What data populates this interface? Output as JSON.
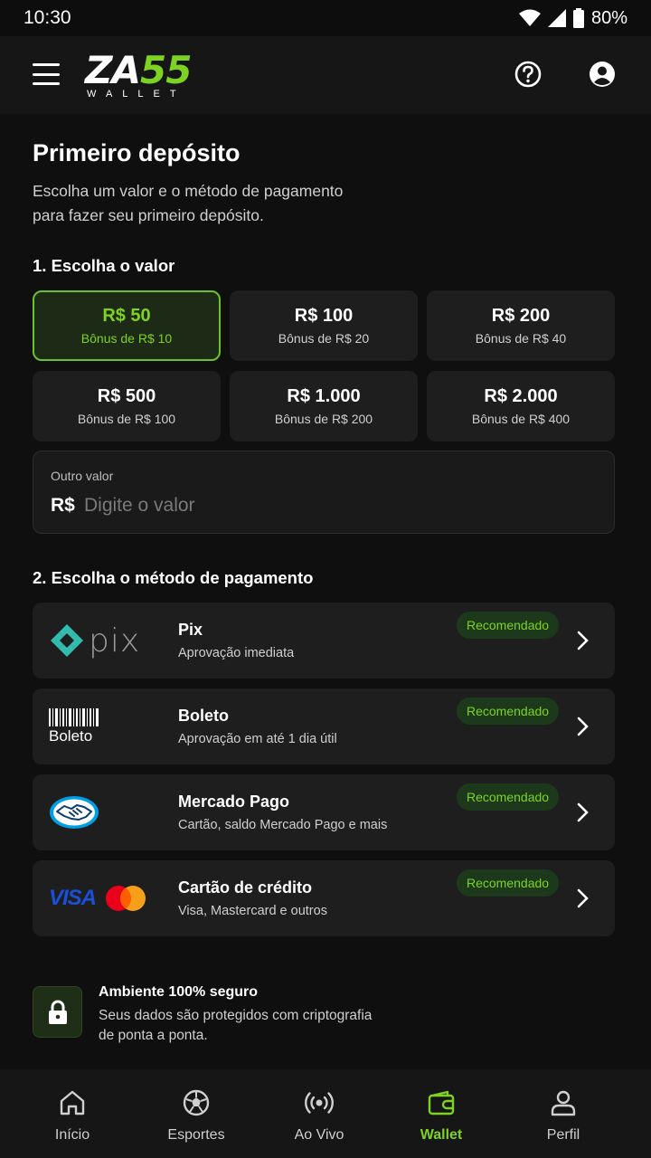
{
  "status_bar": {
    "time": "10:30",
    "battery": "80%"
  },
  "header": {
    "logo_main_a": "ZA",
    "logo_main_b": "55",
    "logo_sub": "WALLET"
  },
  "page": {
    "title": "Primeiro depósito",
    "subtitle": "Escolha um valor e o método de pagamento para fazer seu primeiro depósito."
  },
  "amount_section": {
    "title": "1. Escolha o valor",
    "options": [
      {
        "value": "R$ 50",
        "bonus": "Bônus de R$ 10",
        "selected": true
      },
      {
        "value": "R$ 100",
        "bonus": "Bônus de R$ 20",
        "selected": false
      },
      {
        "value": "R$ 200",
        "bonus": "Bônus de R$ 40",
        "selected": false
      },
      {
        "value": "R$ 500",
        "bonus": "Bônus de R$ 100",
        "selected": false
      },
      {
        "value": "R$ 1.000",
        "bonus": "Bônus de R$ 200",
        "selected": false
      },
      {
        "value": "R$ 2.000",
        "bonus": "Bônus de R$ 400",
        "selected": false
      }
    ],
    "other": {
      "label": "Outro valor",
      "currency": "R$",
      "placeholder": "Digite o valor",
      "value": ""
    }
  },
  "payment_section": {
    "title": "2. Escolha o método de pagamento",
    "methods": [
      {
        "name": "Pix",
        "description": "Aprovação imediata",
        "badge": "Recomendado",
        "logo": "pix-logo",
        "logo_text": "pix"
      },
      {
        "name": "Boleto",
        "description": "Aprovação em até 1 dia útil",
        "badge": "Recomendado",
        "logo": "boleto-logo",
        "logo_text": "Boleto"
      },
      {
        "name": "Mercado Pago",
        "description": "Cartão, saldo Mercado Pago e mais",
        "badge": "Recomendado",
        "logo": "mercado-pago-logo"
      },
      {
        "name": "Cartão de crédito",
        "description": "Visa, Mastercard e outros",
        "badge": "Recomendado",
        "logo": "visa-mastercard-logo",
        "logo_text": "VISA"
      }
    ]
  },
  "security": {
    "title": "Ambiente 100% seguro",
    "description": "Seus dados são protegidos com criptografia de ponta a ponta.",
    "icon": "lock-icon"
  },
  "bottom_nav": [
    {
      "label": "Início",
      "icon": "home-icon",
      "active": false
    },
    {
      "label": "Esportes",
      "icon": "soccer-ball-icon",
      "active": false
    },
    {
      "label": "Ao Vivo",
      "icon": "live-broadcast-icon",
      "active": false
    },
    {
      "label": "Wallet",
      "icon": "wallet-icon",
      "active": true
    },
    {
      "label": "Perfil",
      "icon": "user-icon",
      "active": false
    }
  ],
  "colors": {
    "accent": "#7ed321",
    "background": "#0f0f0f",
    "card": "#1e1e1f",
    "header": "#161616"
  }
}
